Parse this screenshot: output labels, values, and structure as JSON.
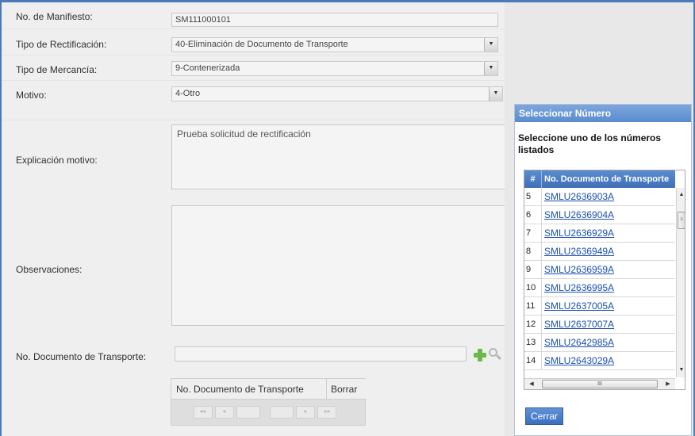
{
  "form": {
    "manifest_label": "No. de Manifiesto:",
    "manifest_value": "SM111000101",
    "rect_type_label": "Tipo de Rectificación:",
    "rect_type_value": "40-Eliminación de Documento de Transporte",
    "goods_type_label": "Tipo de Mercancía:",
    "goods_type_value": "9-Contenerizada",
    "reason_label": "Motivo:",
    "reason_value": "4-Otro",
    "explanation_label": "Explicación motivo:",
    "explanation_value": "Prueba solicitud de rectificación",
    "observations_label": "Observaciones:",
    "observations_value": "",
    "transport_doc_label": "No. Documento de Transporte:",
    "transport_doc_value": ""
  },
  "doc_grid": {
    "col_doc": "No. Documento de Transporte",
    "col_delete": "Borrar",
    "pager": [
      "««",
      "«",
      "",
      "",
      "»",
      "»»"
    ]
  },
  "dialog": {
    "title": "Seleccionar Número",
    "message": "Seleccione uno de los números listados",
    "col_num": "#",
    "col_doc": "No. Documento de Transporte",
    "rows": [
      {
        "num": "5",
        "doc": "SMLU2636903A"
      },
      {
        "num": "6",
        "doc": "SMLU2636904A"
      },
      {
        "num": "7",
        "doc": "SMLU2636929A"
      },
      {
        "num": "8",
        "doc": "SMLU2636949A"
      },
      {
        "num": "9",
        "doc": "SMLU2636959A"
      },
      {
        "num": "10",
        "doc": "SMLU2636995A"
      },
      {
        "num": "11",
        "doc": "SMLU2637005A"
      },
      {
        "num": "12",
        "doc": "SMLU2637007A"
      },
      {
        "num": "13",
        "doc": "SMLU2642985A"
      },
      {
        "num": "14",
        "doc": "SMLU2643029A"
      }
    ],
    "close_label": "Cerrar"
  },
  "icons": {
    "add": "plus-icon",
    "search": "search-icon"
  }
}
